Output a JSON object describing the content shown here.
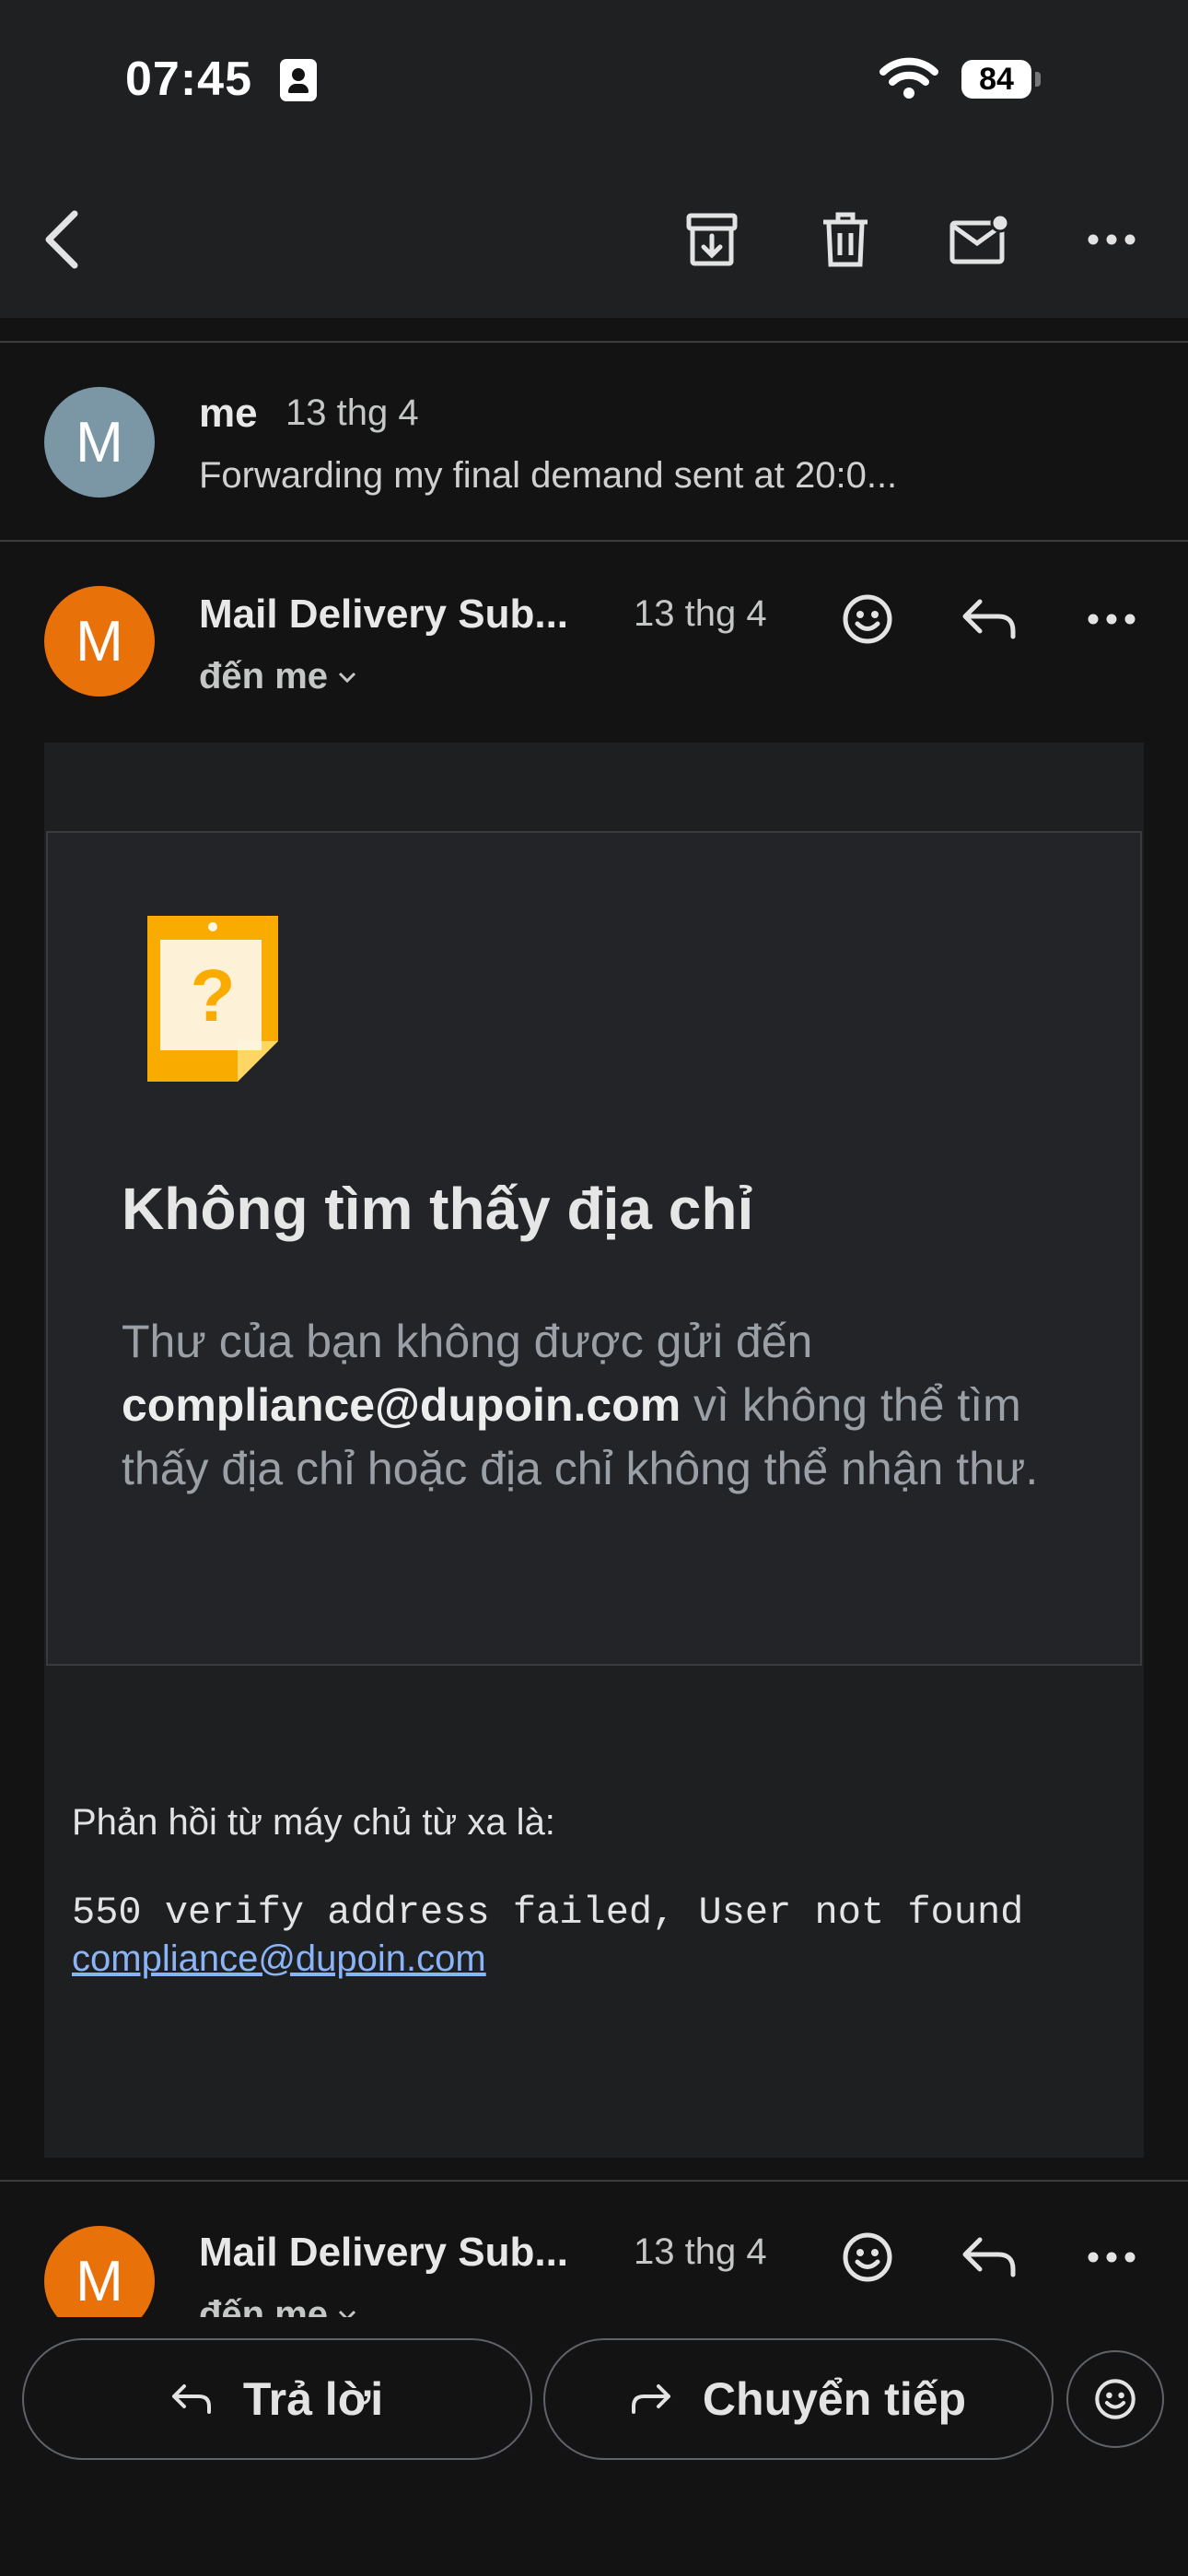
{
  "status_bar": {
    "time": "07:45",
    "battery": "84"
  },
  "toolbar": {
    "icons": [
      "back-arrow-icon",
      "archive-icon",
      "trash-icon",
      "mark-unread-icon",
      "more-icon"
    ]
  },
  "thread": [
    {
      "avatar_letter": "M",
      "sender": "me",
      "date": "13 thg 4",
      "snippet": "Forwarding my final demand sent at 20:0..."
    },
    {
      "avatar_letter": "M",
      "sender": "Mail Delivery Sub...",
      "date": "13 thg 4",
      "recipient": "đến me"
    },
    {
      "avatar_letter": "M",
      "sender": "Mail Delivery Sub...",
      "date": "13 thg 4",
      "recipient": "đến me"
    }
  ],
  "bounce": {
    "title": "Không tìm thấy địa chỉ",
    "text_before": "Thư của bạn không được gửi đến ",
    "email": "compliance@dupoin.com",
    "text_after": " vì không thể tìm thấy địa chỉ hoặc địa chỉ không thể nhận thư.",
    "remote_label": "Phản hồi từ máy chủ từ xa là:",
    "remote_code": "550 verify address failed, User not found",
    "remote_link": "compliance@dupoin.com"
  },
  "actions": {
    "reply": "Trả lời",
    "forward": "Chuyển tiếp"
  },
  "colors": {
    "avatar_me": "#7b96a4",
    "avatar_delivery": "#e8710a",
    "link": "#8ab4f8",
    "icon_orange": "#f9ab00"
  }
}
